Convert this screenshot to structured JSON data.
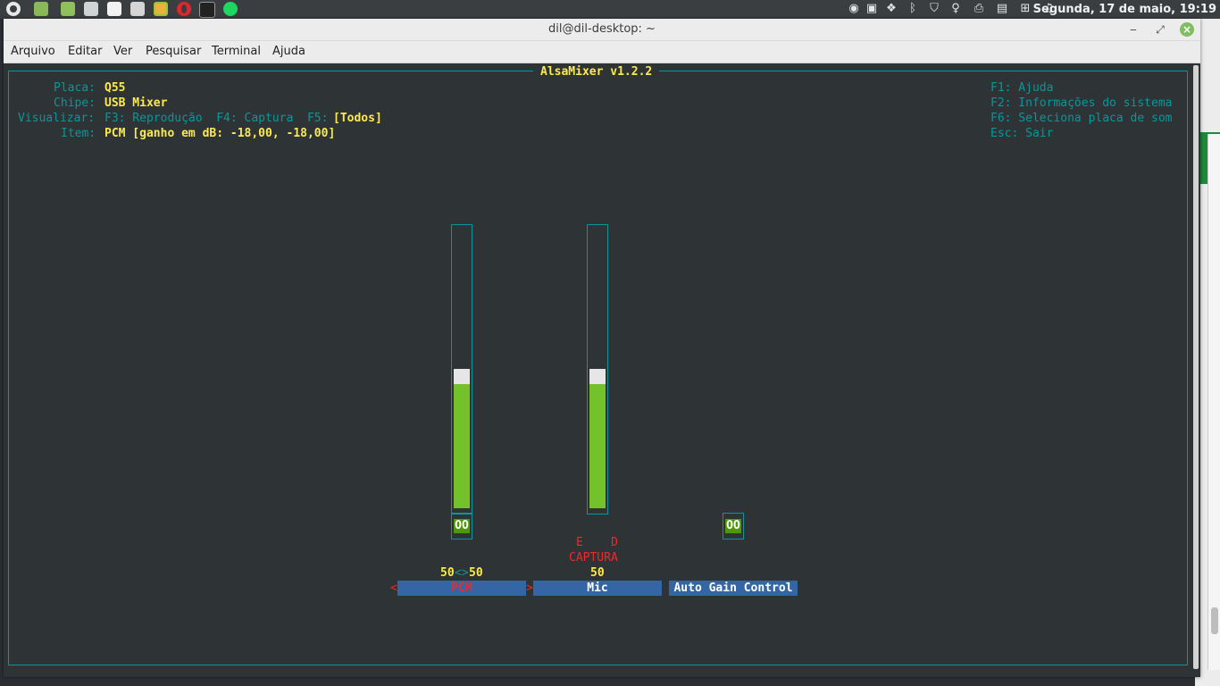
{
  "panel": {
    "clock": "Segunda, 17 de maio, 19:19",
    "launchers": [
      "menu-icon",
      "files-icon",
      "folder-icon",
      "settings-icon",
      "text-editor-icon",
      "calculator-icon",
      "chrome-icon",
      "opera-icon",
      "terminal-icon",
      "spotify-icon"
    ],
    "tray": [
      "update-icon",
      "clipboard-icon",
      "dropbox-icon",
      "bluetooth-icon",
      "shield-icon",
      "redshift-icon",
      "printer-icon",
      "notes-icon",
      "network-icon",
      "sound-icon"
    ]
  },
  "window": {
    "title": "dil@dil-desktop: ~",
    "minimize": "‒",
    "maximize": "⤢",
    "close": "×",
    "menu": [
      "Arquivo",
      "Editar",
      "Ver",
      "Pesquisar",
      "Terminal",
      "Ajuda"
    ]
  },
  "mixer": {
    "title": "AlsaMixer v1.2.2",
    "info": {
      "placa_label": "Placa:",
      "placa_value": "Q55",
      "chipe_label": "Chipe:",
      "chipe_value": "USB Mixer",
      "visualizar_label": "Visualizar:",
      "visualizar_opts": "F3: Reprodução  F4: Captura  F5:",
      "visualizar_selected": "[Todos]",
      "item_label": "Item:",
      "item_value": "PCM [ganho em dB: -18,00, -18,00]"
    },
    "help": [
      "F1: Ajuda",
      "F2: Informações do sistema",
      "F6: Seleciona placa de som",
      "Esc: Sair"
    ],
    "controls": [
      {
        "name": "PCM",
        "level": 0.5,
        "value_left": "50",
        "value_sep": "<>",
        "value_right": "50",
        "mute": "OO",
        "selected": true
      },
      {
        "name": "Mic",
        "level": 0.5,
        "value": "50",
        "capture_lr": "E    D",
        "capture": "CAPTURA"
      },
      {
        "name": "Auto Gain Control",
        "mute": "OO"
      }
    ],
    "selected_left_arrow": "<",
    "selected_right_arrow": ">"
  },
  "colors": {
    "terminal_bg": "#2e3436",
    "cyan": "#06989a",
    "yellow": "#fce94f",
    "green_fill": "#73c12b",
    "mute_green": "#4e9a06",
    "label_blue": "#3465a4",
    "red": "#ef2929"
  }
}
